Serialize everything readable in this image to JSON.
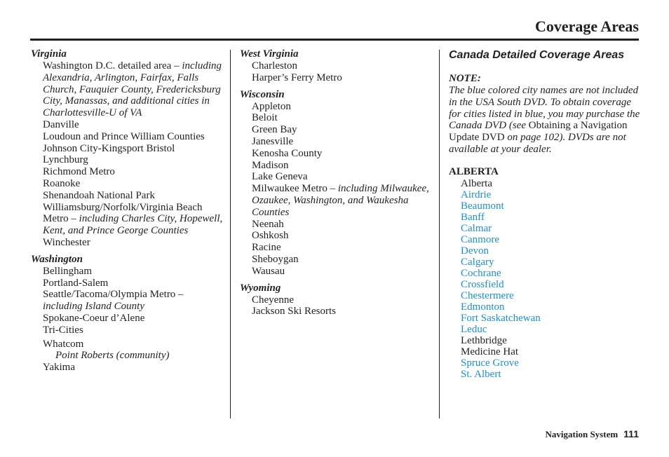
{
  "header": {
    "title": "Coverage Areas"
  },
  "column1": {
    "sections": [
      {
        "state": "Virginia",
        "entries": [
          {
            "text": "Washington D.C. detailed area – ",
            "italic_note": "including Alexandria, Arlington, Fairfax, Falls Church, Fauquier County, Fredericksburg City, Manassas, and additional cities in Charlottesville-U of VA"
          },
          {
            "text": "Danville"
          },
          {
            "text": "Loudoun and Prince William Counties"
          },
          {
            "text": "Johnson City-Kingsport Bristol"
          },
          {
            "text": "Lynchburg"
          },
          {
            "text": "Richmond Metro"
          },
          {
            "text": "Roanoke"
          },
          {
            "text": "Shenandoah National Park"
          },
          {
            "text": "Williamsburg/Norfolk/Virginia Beach Metro – ",
            "italic_note": "including Charles City, Hopewell, Kent, and Prince George Counties"
          },
          {
            "text": "Winchester"
          }
        ]
      },
      {
        "state": "Washington",
        "entries": [
          {
            "text": "Bellingham"
          },
          {
            "text": "Portland-Salem"
          },
          {
            "text": "Seattle/Tacoma/Olympia Metro – ",
            "italic_note": "including Island County"
          },
          {
            "text": "Spokane-Coeur d’Alene"
          },
          {
            "text": "Tri-Cities"
          },
          {
            "text": "Whatcom",
            "sub": "Point Roberts (community)"
          },
          {
            "text": "Yakima"
          }
        ]
      }
    ]
  },
  "column2": {
    "sections": [
      {
        "state": "West Virginia",
        "entries": [
          {
            "text": "Charleston"
          },
          {
            "text": "Harper’s Ferry Metro"
          }
        ]
      },
      {
        "state": "Wisconsin",
        "entries": [
          {
            "text": "Appleton"
          },
          {
            "text": "Beloit"
          },
          {
            "text": "Green Bay"
          },
          {
            "text": "Janesville"
          },
          {
            "text": "Kenosha County"
          },
          {
            "text": "Madison"
          },
          {
            "text": "Lake Geneva"
          },
          {
            "text": "Milwaukee Metro – ",
            "italic_note": "including Milwaukee, Ozaukee, Washington, and Waukesha Counties"
          },
          {
            "text": "Neenah"
          },
          {
            "text": "Oshkosh"
          },
          {
            "text": "Racine"
          },
          {
            "text": "Sheboygan"
          },
          {
            "text": "Wausau"
          }
        ]
      },
      {
        "state": "Wyoming",
        "entries": [
          {
            "text": "Cheyenne"
          },
          {
            "text": "Jackson Ski Resorts"
          }
        ]
      }
    ]
  },
  "column3": {
    "heading": "Canada Detailed Coverage Areas",
    "note_label": "NOTE:",
    "note_part1": "The blue colored city names are not included in the USA South DVD. To obtain coverage for cities listed in blue, you may purchase the Canada DVD (see ",
    "note_link": "Obtaining a Navigation Update DVD",
    "note_part2": " on page 102). DVDs are not available at your dealer.",
    "province": "ALBERTA",
    "cities": [
      {
        "name": "Alberta",
        "blue": false
      },
      {
        "name": "Airdrie",
        "blue": true
      },
      {
        "name": "Beaumont",
        "blue": true
      },
      {
        "name": "Banff",
        "blue": true
      },
      {
        "name": "Calmar",
        "blue": true
      },
      {
        "name": "Canmore",
        "blue": true
      },
      {
        "name": "Devon",
        "blue": true
      },
      {
        "name": "Calgary",
        "blue": true
      },
      {
        "name": "Cochrane",
        "blue": true
      },
      {
        "name": "Crossfield",
        "blue": true
      },
      {
        "name": "Chestermere",
        "blue": true
      },
      {
        "name": "Edmonton",
        "blue": true
      },
      {
        "name": "Fort Saskatchewan",
        "blue": true
      },
      {
        "name": "Leduc",
        "blue": true
      },
      {
        "name": "Lethbridge",
        "blue": false
      },
      {
        "name": "Medicine Hat",
        "blue": false
      },
      {
        "name": "Spruce Grove",
        "blue": true
      },
      {
        "name": "St. Albert",
        "blue": true
      }
    ],
    "colors": {
      "blue_city": "#1a8fd8",
      "text": "#231f20"
    }
  },
  "footer": {
    "section": "Navigation System",
    "page_number": "111"
  }
}
